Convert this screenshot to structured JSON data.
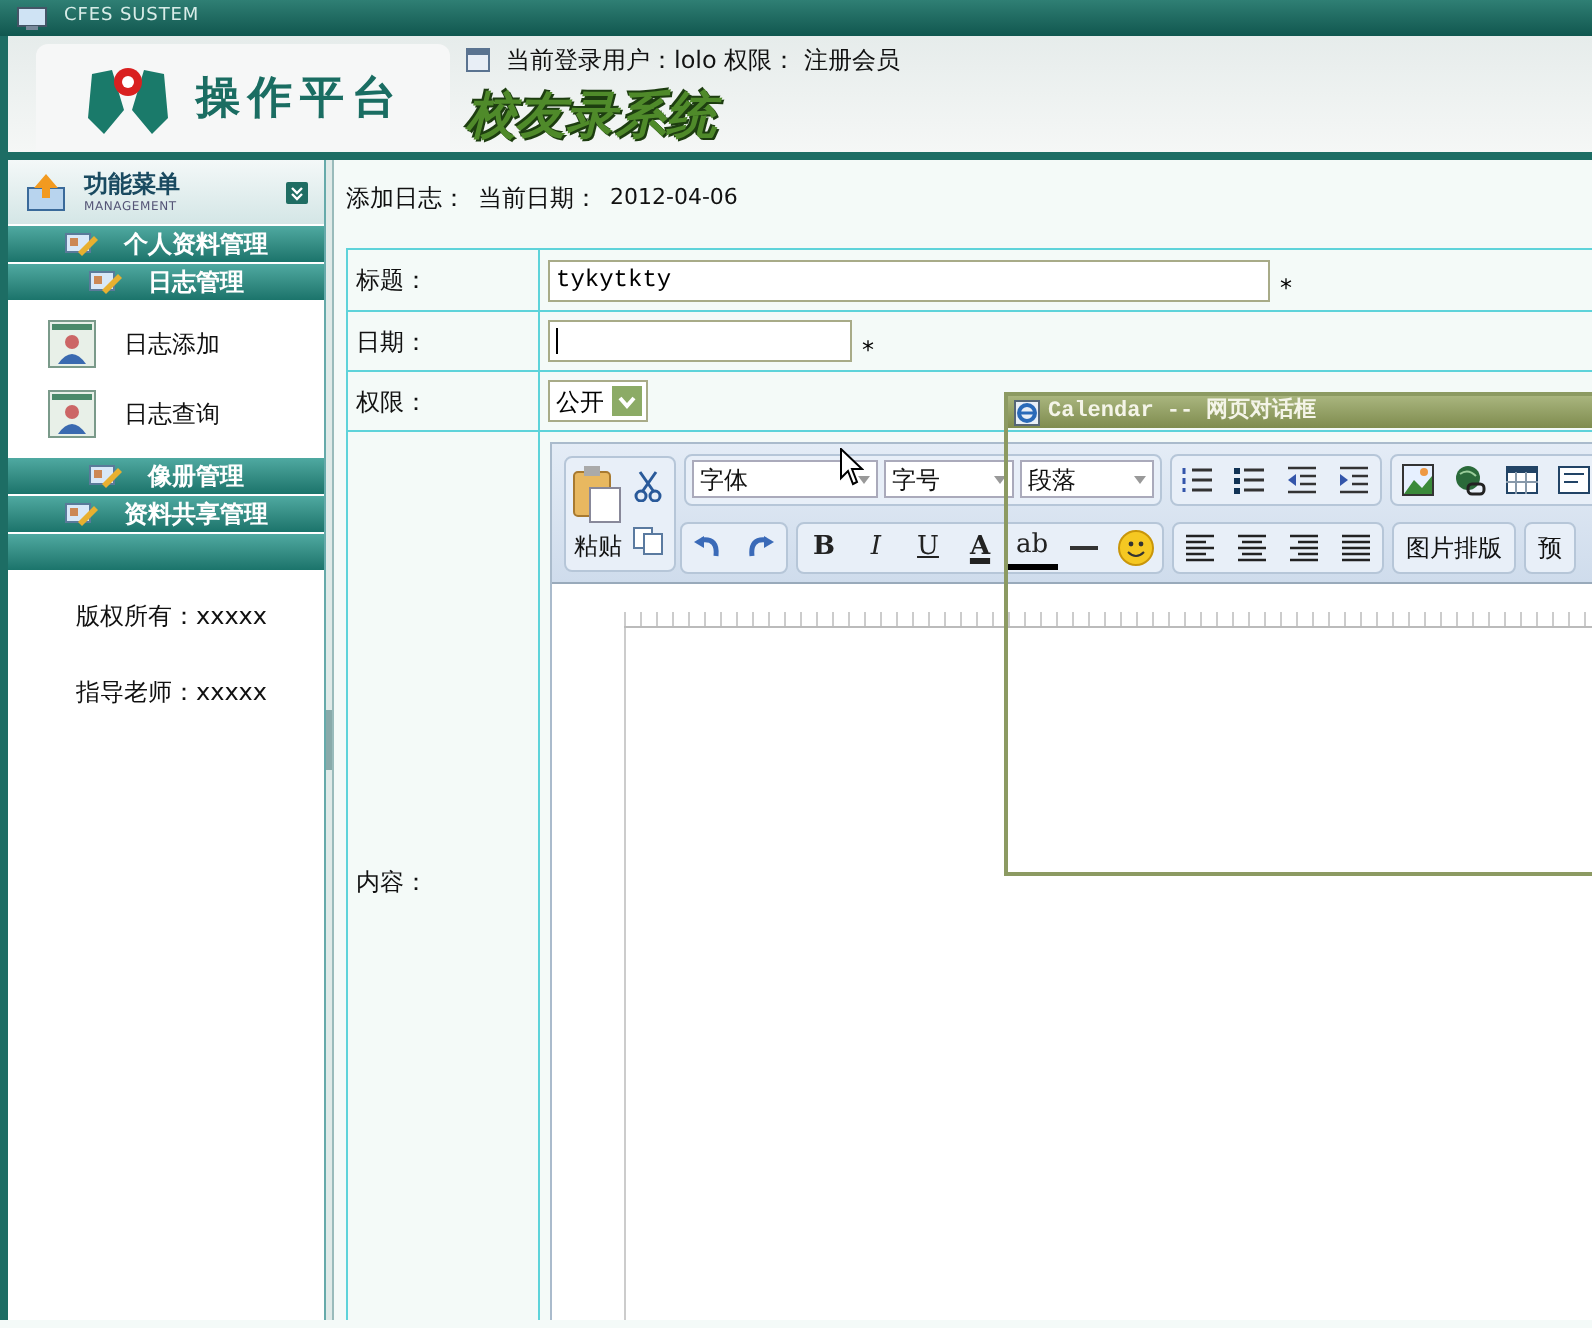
{
  "window": {
    "title": "CFES SUSTEM"
  },
  "header": {
    "platform_title": "操作平台",
    "user_info": "当前登录用户：lolo 权限： 注册会员",
    "system_title": "校友录系统"
  },
  "sidebar": {
    "menu_title": "功能菜单",
    "menu_subtitle": "MANAGEMENT",
    "sections": [
      {
        "label": "个人资料管理"
      },
      {
        "label": "日志管理",
        "items": [
          {
            "label": "日志添加"
          },
          {
            "label": "日志查询"
          }
        ]
      },
      {
        "label": "像册管理"
      },
      {
        "label": "资料共享管理"
      }
    ],
    "footer": [
      "版权所有：xxxxx",
      "指导老师：xxxxx"
    ]
  },
  "page": {
    "heading": "添加日志：",
    "date_label": "当前日期：",
    "date": "2012-04-06"
  },
  "form": {
    "rows": [
      {
        "kind": "text",
        "label": "标题：",
        "value": "tykytkty",
        "required_mark": "*"
      },
      {
        "kind": "text",
        "label": "日期：",
        "focused": true,
        "required_mark": "*"
      },
      {
        "kind": "select",
        "label": "权限：",
        "value": "公开"
      },
      {
        "kind": "editor",
        "label": "内容："
      }
    ]
  },
  "editor": {
    "paste_label": "粘贴",
    "dropdowns": [
      "字体",
      "字号",
      "段落"
    ],
    "format_buttons": [
      "B",
      "I",
      "U",
      "A",
      "ab"
    ],
    "text_buttons": [
      "图片排版",
      "预"
    ]
  },
  "dialog": {
    "title": "Calendar -- 网页对话框"
  }
}
